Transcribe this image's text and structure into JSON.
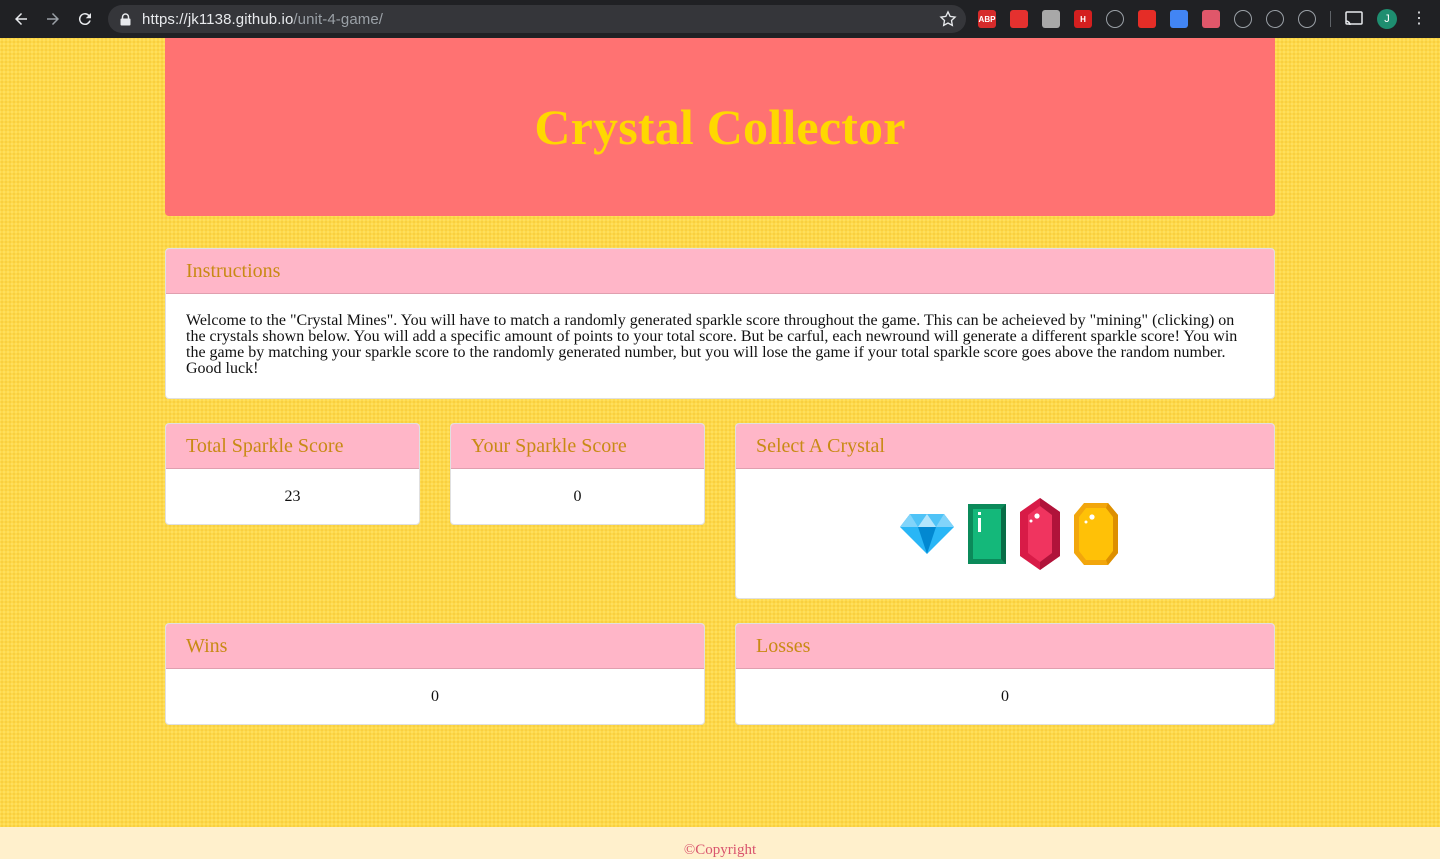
{
  "browser": {
    "url_host": "https://jk1138.github.io",
    "url_path": "/unit-4-game/",
    "extensions": [
      {
        "name": "adblock-plus-icon",
        "label": "ABP",
        "color": "#d62b2b"
      },
      {
        "name": "stop-hand-icon",
        "label": "",
        "color": "#e5312f"
      },
      {
        "name": "kanji-extension-icon",
        "label": "",
        "color": "#a8a8a8"
      },
      {
        "name": "honey-extension-icon",
        "label": "H",
        "color": "#d41f1f"
      },
      {
        "name": "red-arrow-icon",
        "label": "",
        "color": "#202124"
      },
      {
        "name": "youtube-icon",
        "label": "",
        "color": "#e52d27"
      },
      {
        "name": "google-translate-icon",
        "label": "",
        "color": "#4285f4"
      },
      {
        "name": "video-record-icon",
        "label": "",
        "color": "#e0576a"
      },
      {
        "name": "links-extension-icon",
        "label": "",
        "color": "#202124"
      },
      {
        "name": "screenshot-frame-icon",
        "label": "",
        "color": "#202124"
      },
      {
        "name": "globe-extension-icon",
        "label": "",
        "color": "#202124"
      }
    ],
    "profile_initial": "J"
  },
  "header": {
    "title": "Crystal Collector"
  },
  "instructions": {
    "heading": "Instructions",
    "text": "Welcome to the \"Crystal Mines\". You will have to match a randomly generated sparkle score throughout the game. This can be acheieved by \"mining\" (clicking) on the crystals shown below. You will add a specific amount of points to your total score. But be carful, each newround will generate a different sparkle score! You win the game by matching your sparkle score to the randomly generated number, but you will lose the game if your total sparkle score goes above the random number. Good luck!"
  },
  "scores": {
    "total_heading": "Total Sparkle Score",
    "total_value": "23",
    "yours_heading": "Your Sparkle Score",
    "yours_value": "0"
  },
  "crystals": {
    "heading": "Select A Crystal",
    "items": [
      "blue-diamond",
      "green-emerald",
      "red-ruby",
      "yellow-topaz"
    ]
  },
  "record": {
    "wins_heading": "Wins",
    "wins_value": "0",
    "losses_heading": "Losses",
    "losses_value": "0"
  },
  "footer": {
    "copyright": "©Copyright"
  },
  "colors": {
    "page_background": "#fed94a",
    "jumbotron": "#ff7272",
    "title_text": "#ffd800",
    "card_header": "#ffb6c8",
    "card_header_text": "#c88a14",
    "footer_background": "#fff0cc",
    "footer_text": "#d9546e"
  }
}
